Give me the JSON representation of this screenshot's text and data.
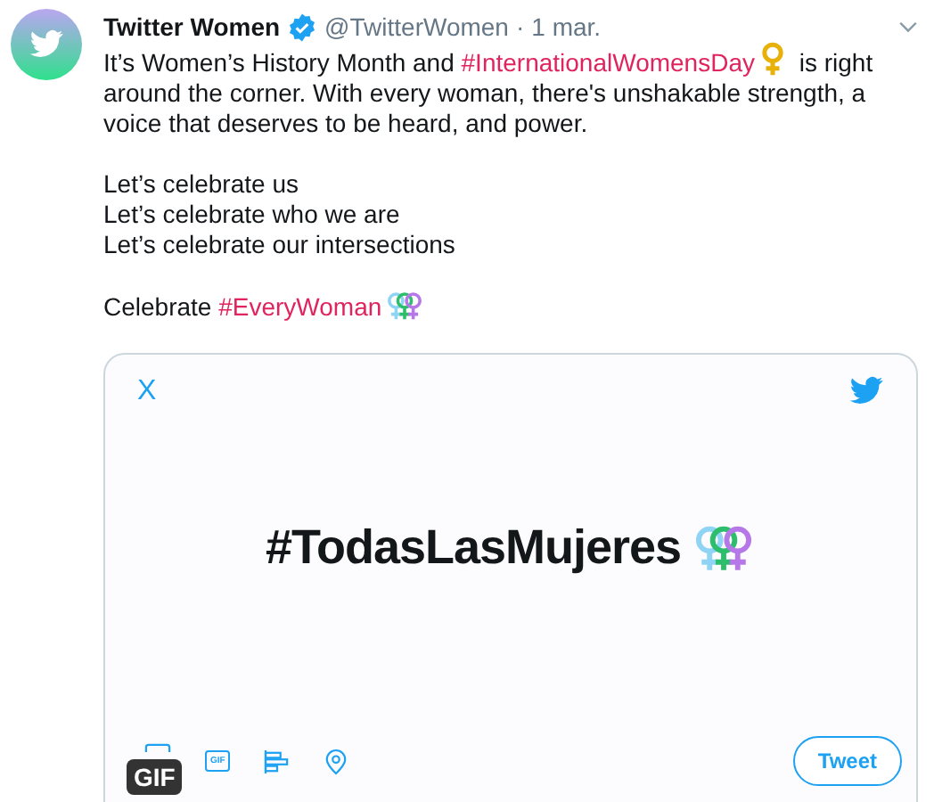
{
  "tweet": {
    "author": "Twitter Women",
    "verified": true,
    "handle": "@TwitterWomen",
    "separator": "·",
    "date": "1 mar.",
    "paragraphs": [
      [
        {
          "kind": "text",
          "text": "It’s Women’s History Month and "
        },
        {
          "kind": "hashtag",
          "text": "#InternationalWomensDay"
        },
        {
          "kind": "female-sign"
        },
        {
          "kind": "text",
          "text": " is right around the corner. With every woman, there's unshakable strength, a voice that deserves to be heard, and power."
        }
      ],
      [
        {
          "kind": "line",
          "text": "Let’s celebrate us"
        },
        {
          "kind": "line",
          "text": "Let’s celebrate who we are"
        },
        {
          "kind": "line",
          "text": "Let’s celebrate our intersections"
        }
      ],
      [
        {
          "kind": "text",
          "text": "Celebrate "
        },
        {
          "kind": "hashtag",
          "text": "#EveryWoman"
        },
        {
          "kind": "female-signs"
        }
      ]
    ],
    "media": {
      "close": "X",
      "headline": "#TodasLasMujeres",
      "badge": "GIF",
      "gif_icon": "GIF",
      "button": "Tweet"
    }
  }
}
